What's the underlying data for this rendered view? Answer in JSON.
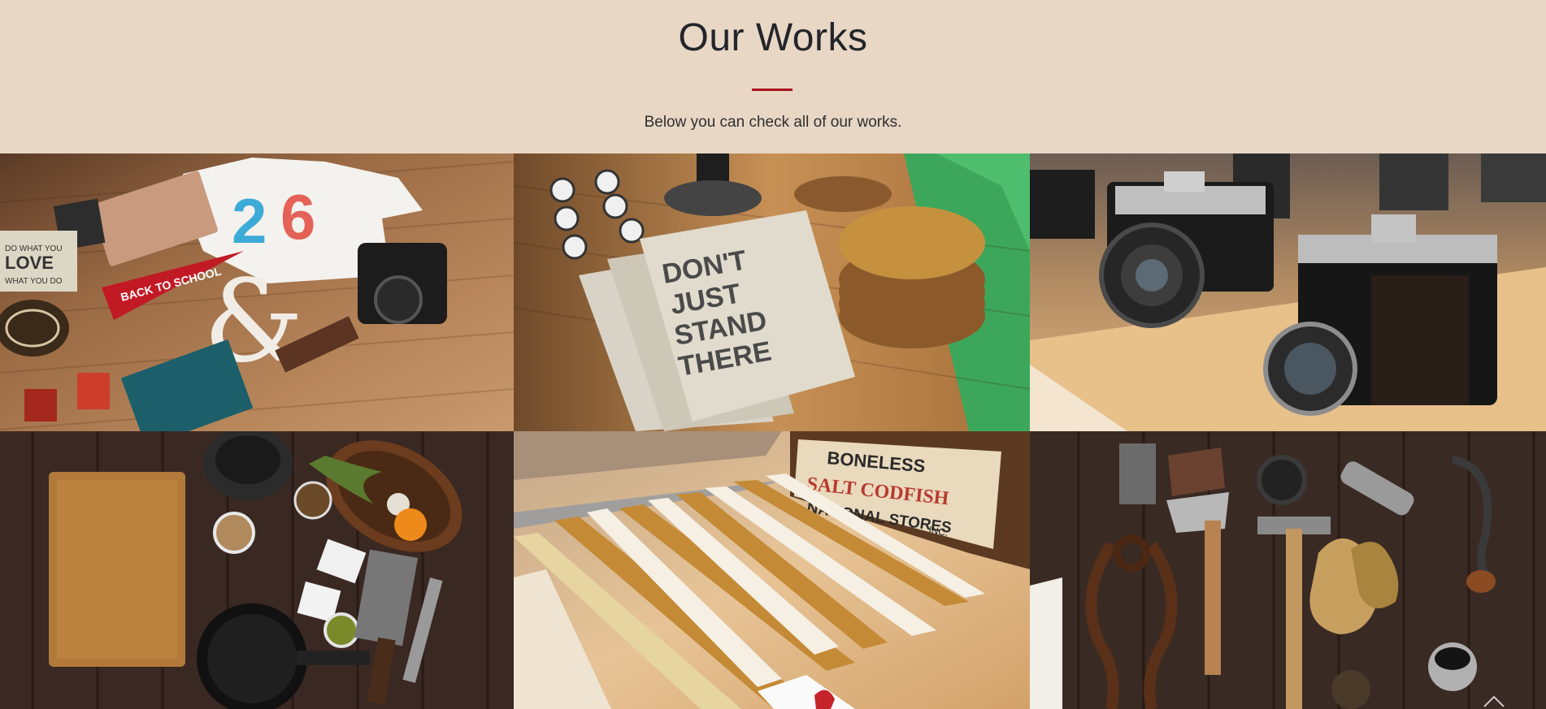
{
  "section": {
    "title": "Our Works",
    "subtitle": "Below you can check all of our works.",
    "accent_color": "#a8141c",
    "background_color": "#e8d7c5"
  },
  "gallery": {
    "items": [
      {
        "subject": "flat-lay of design objects on a wooden table",
        "printed_text": [
          "DO WHAT YOU",
          "LOVE",
          "WHAT YOU DO",
          "BACK TO SCHOOL",
          "&"
        ]
      },
      {
        "subject": "notebooks and wooden coasters on a wooden table",
        "printed_text": [
          "DON'T",
          "JUST",
          "STAND",
          "THERE"
        ]
      },
      {
        "subject": "two vintage cameras on a wooden shelf",
        "printed_text": []
      },
      {
        "subject": "kitchen items on a dark wooden table",
        "printed_text": []
      },
      {
        "subject": "folding rulers beside a wooden box",
        "printed_text": [
          "BONELESS",
          "SALT CODFISH",
          "NATIONAL STORES",
          "INC."
        ]
      },
      {
        "subject": "vintage hand tools on a dark wooden table",
        "printed_text": []
      }
    ]
  },
  "scroll_top": {
    "icon": "chevron-up-icon"
  }
}
